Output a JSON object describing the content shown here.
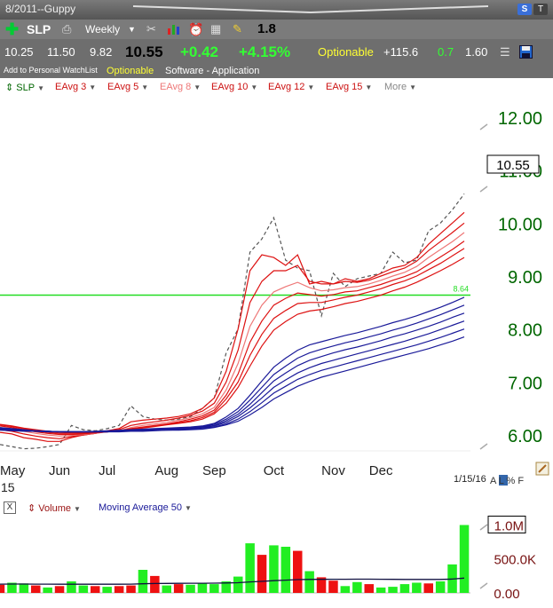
{
  "window": {
    "title": "8/2011--Guppy"
  },
  "toolbar": {
    "symbol": "SLP",
    "period": "Weekly",
    "value": "1.8"
  },
  "quote": {
    "open": "10.25",
    "high": "11.50",
    "low": "9.82",
    "last": "10.55",
    "change": "+0.42",
    "change_pct": "+4.15%",
    "optionable": "Optionable",
    "stat1": "+115.6",
    "stat2": "0.7",
    "stat3": "1.60"
  },
  "info": {
    "watchlist": "Add to Personal WatchList",
    "optionable": "Optionable",
    "industry": "Software - Application"
  },
  "legend": {
    "symbol": "SLP",
    "items": [
      "EAvg 3",
      "EAvg 5",
      "EAvg 8",
      "EAvg 10",
      "EAvg 12",
      "EAvg 15"
    ],
    "more": "More"
  },
  "footer": {
    "date": "1/15/16",
    "flags": "A L % F"
  },
  "volume_legend": {
    "close": "X",
    "volume": "Volume",
    "ma": "Moving Average 50"
  },
  "colors": {
    "price": "#555555",
    "eavg_red": "#dd1111",
    "eavg_pink": "#ee7777",
    "eavg_blue": "#1a1a99",
    "hline": "#22dd22",
    "axis_text": "#006600",
    "vol_up": "#22ee22",
    "vol_down": "#ee1111",
    "vol_ma": "#101040"
  },
  "chart_data": [
    {
      "type": "line",
      "ylim": [
        5.7,
        12.4
      ],
      "yticks": [
        "6.00",
        "7.00",
        "8.00",
        "9.00",
        "10.00",
        "11.00",
        "12.00"
      ],
      "yticks_values": [
        6,
        7,
        8,
        9,
        10,
        11,
        12
      ],
      "xticks": [
        "May",
        "Jun",
        "Jul",
        "Aug",
        "Sep",
        "Oct",
        "Nov",
        "Dec"
      ],
      "xticks_week_index": [
        0,
        5,
        9,
        14,
        18,
        23,
        28,
        32
      ],
      "x_sublabel": "15",
      "last_value_label": "10.55",
      "last_value": 10.55,
      "hline": {
        "value": 8.64,
        "label": "8.64"
      },
      "series": [
        {
          "values": [
            5.82,
            5.78,
            5.74,
            5.75,
            5.78,
            5.82,
            6.18,
            6.1,
            6.08,
            6.12,
            6.18,
            6.55,
            6.35,
            6.3,
            6.28,
            6.3,
            6.35,
            6.5,
            6.7,
            7.55,
            8.0,
            9.45,
            9.7,
            10.1,
            9.3,
            9.15,
            9.1,
            8.25,
            9.05,
            8.8,
            8.95,
            9.0,
            9.05,
            9.45,
            9.25,
            9.3,
            9.85,
            10.0,
            10.25,
            10.55
          ]
        },
        {
          "values": [
            6.05,
            6.02,
            5.95,
            5.92,
            5.88,
            5.88,
            5.95,
            6.0,
            6.03,
            6.08,
            6.12,
            6.25,
            6.28,
            6.3,
            6.32,
            6.35,
            6.4,
            6.5,
            6.7,
            7.2,
            8.0,
            9.1,
            9.4,
            9.35,
            9.2,
            9.4,
            8.85,
            8.9,
            8.85,
            8.95,
            8.9,
            8.95,
            9.05,
            9.15,
            9.2,
            9.35,
            9.6,
            9.8,
            10.0,
            10.2
          ]
        },
        {
          "values": [
            6.1,
            6.07,
            6.02,
            5.98,
            5.95,
            5.93,
            5.97,
            6.0,
            6.03,
            6.07,
            6.1,
            6.18,
            6.22,
            6.25,
            6.28,
            6.32,
            6.37,
            6.45,
            6.6,
            7.0,
            7.6,
            8.5,
            8.9,
            9.1,
            9.1,
            9.2,
            8.9,
            8.85,
            8.85,
            8.9,
            8.88,
            8.92,
            9.0,
            9.08,
            9.15,
            9.28,
            9.48,
            9.65,
            9.82,
            10.0
          ]
        },
        {
          "values": [
            6.14,
            6.11,
            6.07,
            6.03,
            6.0,
            5.98,
            5.99,
            6.01,
            6.03,
            6.06,
            6.08,
            6.14,
            6.18,
            6.21,
            6.24,
            6.28,
            6.33,
            6.4,
            6.52,
            6.85,
            7.35,
            8.05,
            8.45,
            8.7,
            8.8,
            8.88,
            8.78,
            8.72,
            8.74,
            8.78,
            8.8,
            8.85,
            8.92,
            9.0,
            9.07,
            9.18,
            9.35,
            9.5,
            9.65,
            9.82
          ]
        },
        {
          "values": [
            6.17,
            6.14,
            6.1,
            6.06,
            6.03,
            6.01,
            6.01,
            6.02,
            6.04,
            6.06,
            6.08,
            6.12,
            6.15,
            6.18,
            6.21,
            6.25,
            6.3,
            6.36,
            6.47,
            6.75,
            7.15,
            7.75,
            8.15,
            8.45,
            8.58,
            8.68,
            8.65,
            8.62,
            8.65,
            8.7,
            8.72,
            8.78,
            8.84,
            8.92,
            8.99,
            9.08,
            9.22,
            9.36,
            9.5,
            9.66
          ]
        },
        {
          "values": [
            6.19,
            6.16,
            6.12,
            6.08,
            6.05,
            6.03,
            6.03,
            6.03,
            6.04,
            6.06,
            6.08,
            6.11,
            6.14,
            6.17,
            6.2,
            6.23,
            6.27,
            6.33,
            6.43,
            6.68,
            7.0,
            7.5,
            7.9,
            8.2,
            8.35,
            8.48,
            8.5,
            8.5,
            8.55,
            8.6,
            8.64,
            8.7,
            8.76,
            8.84,
            8.91,
            9.0,
            9.12,
            9.24,
            9.38,
            9.52
          ]
        },
        {
          "values": [
            6.2,
            6.17,
            6.13,
            6.1,
            6.07,
            6.05,
            6.04,
            6.04,
            6.05,
            6.06,
            6.08,
            6.1,
            6.13,
            6.16,
            6.19,
            6.22,
            6.25,
            6.3,
            6.4,
            6.6,
            6.9,
            7.3,
            7.68,
            7.98,
            8.14,
            8.28,
            8.34,
            8.37,
            8.42,
            8.48,
            8.52,
            8.58,
            8.64,
            8.72,
            8.79,
            8.88,
            8.99,
            9.1,
            9.22,
            9.35
          ]
        },
        {
          "values": [
            6.14,
            6.12,
            6.1,
            6.08,
            6.07,
            6.06,
            6.06,
            6.06,
            6.07,
            6.08,
            6.09,
            6.1,
            6.11,
            6.12,
            6.13,
            6.14,
            6.15,
            6.17,
            6.22,
            6.34,
            6.5,
            6.75,
            7.02,
            7.28,
            7.45,
            7.6,
            7.7,
            7.76,
            7.82,
            7.88,
            7.93,
            7.99,
            8.05,
            8.12,
            8.18,
            8.25,
            8.33,
            8.41,
            8.5,
            8.6
          ]
        },
        {
          "values": [
            6.13,
            6.11,
            6.09,
            6.08,
            6.07,
            6.06,
            6.06,
            6.06,
            6.06,
            6.07,
            6.08,
            6.09,
            6.1,
            6.11,
            6.12,
            6.13,
            6.14,
            6.16,
            6.2,
            6.3,
            6.44,
            6.66,
            6.9,
            7.14,
            7.3,
            7.45,
            7.55,
            7.62,
            7.68,
            7.74,
            7.79,
            7.85,
            7.91,
            7.98,
            8.04,
            8.11,
            8.19,
            8.27,
            8.36,
            8.45
          ]
        },
        {
          "values": [
            6.12,
            6.1,
            6.09,
            6.08,
            6.07,
            6.06,
            6.06,
            6.06,
            6.06,
            6.07,
            6.07,
            6.08,
            6.09,
            6.1,
            6.11,
            6.12,
            6.13,
            6.15,
            6.18,
            6.27,
            6.39,
            6.58,
            6.8,
            7.02,
            7.17,
            7.31,
            7.41,
            7.48,
            7.55,
            7.61,
            7.66,
            7.72,
            7.78,
            7.85,
            7.91,
            7.98,
            8.05,
            8.13,
            8.22,
            8.3
          ]
        },
        {
          "values": [
            6.11,
            6.1,
            6.08,
            6.07,
            6.07,
            6.06,
            6.06,
            6.06,
            6.06,
            6.06,
            6.07,
            6.08,
            6.08,
            6.09,
            6.1,
            6.11,
            6.12,
            6.14,
            6.17,
            6.24,
            6.35,
            6.51,
            6.7,
            6.9,
            7.04,
            7.17,
            7.27,
            7.35,
            7.41,
            7.47,
            7.53,
            7.59,
            7.65,
            7.71,
            7.77,
            7.84,
            7.91,
            7.99,
            8.07,
            8.15
          ]
        },
        {
          "values": [
            6.1,
            6.09,
            6.08,
            6.07,
            6.06,
            6.06,
            6.06,
            6.06,
            6.06,
            6.06,
            6.07,
            6.07,
            6.08,
            6.09,
            6.09,
            6.1,
            6.11,
            6.13,
            6.15,
            6.21,
            6.3,
            6.44,
            6.61,
            6.79,
            6.92,
            7.05,
            7.14,
            7.22,
            7.28,
            7.34,
            7.4,
            7.46,
            7.52,
            7.58,
            7.64,
            7.7,
            7.77,
            7.84,
            7.92,
            8.0
          ]
        },
        {
          "values": [
            6.09,
            6.08,
            6.07,
            6.07,
            6.06,
            6.06,
            6.06,
            6.06,
            6.06,
            6.06,
            6.06,
            6.07,
            6.07,
            6.08,
            6.09,
            6.09,
            6.1,
            6.11,
            6.14,
            6.19,
            6.26,
            6.38,
            6.52,
            6.68,
            6.8,
            6.92,
            7.01,
            7.09,
            7.15,
            7.21,
            7.27,
            7.33,
            7.39,
            7.45,
            7.51,
            7.57,
            7.63,
            7.7,
            7.77,
            7.85
          ]
        }
      ]
    },
    {
      "type": "bar",
      "ylim": [
        0,
        1150
      ],
      "yticks": [
        "0.00",
        "500.0K",
        "1.0M"
      ],
      "yticks_values": [
        0,
        500,
        1000
      ],
      "values": [
        120,
        150,
        140,
        110,
        80,
        100,
        170,
        110,
        100,
        90,
        100,
        110,
        340,
        250,
        110,
        130,
        120,
        150,
        130,
        170,
        240,
        730,
        560,
        700,
        680,
        620,
        320,
        230,
        180,
        100,
        160,
        130,
        80,
        90,
        130,
        150,
        140,
        170,
        420,
        1000
      ],
      "colors": [
        "down",
        "up",
        "up",
        "down",
        "up",
        "down",
        "up",
        "up",
        "down",
        "up",
        "down",
        "down",
        "up",
        "down",
        "up",
        "down",
        "up",
        "up",
        "up",
        "up",
        "up",
        "up",
        "down",
        "up",
        "up",
        "down",
        "up",
        "down",
        "down",
        "up",
        "up",
        "down",
        "up",
        "up",
        "up",
        "up",
        "down",
        "up",
        "up",
        "up"
      ],
      "ma": [
        130,
        131,
        131,
        130,
        129,
        128,
        128,
        128,
        128,
        128,
        128,
        129,
        135,
        139,
        140,
        141,
        142,
        143,
        144,
        146,
        150,
        162,
        170,
        180,
        188,
        196,
        198,
        200,
        201,
        201,
        202,
        202,
        201,
        200,
        199,
        199,
        198,
        198,
        204,
        218
      ]
    }
  ]
}
